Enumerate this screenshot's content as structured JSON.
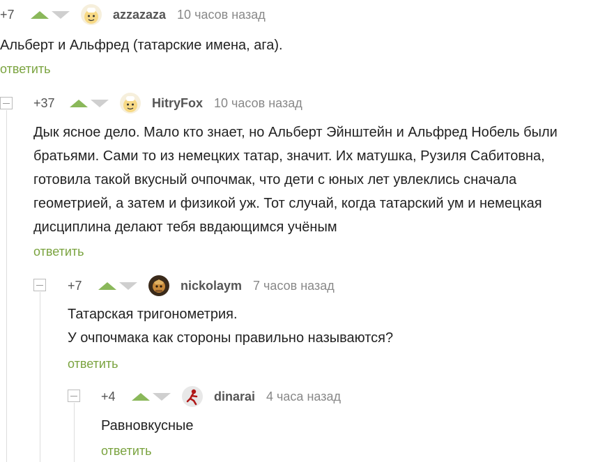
{
  "comments": [
    {
      "rating": "+7",
      "user": "azzazaza",
      "time": "10 часов назад",
      "lines": [
        "Альберт и Альфред (татарские имена, ага)."
      ],
      "reply": "ответить",
      "avatar_icon": "cartoon-face-avatar-icon"
    },
    {
      "rating": "+37",
      "user": "HitryFox",
      "time": "10 часов назад",
      "lines": [
        "Дык ясное дело. Мало кто знает, но Альберт Эйнштейн и Альфред Нобель были",
        "братьями. Сами то из немецких татар, значит. Их матушка, Рузиля Сабитовна,",
        "готовила такой вкусный очпочмак, что дети с юных лет увлеклись сначала",
        "геометрией, а затем и физикой уж. Тот случай, когда татарский ум и немецкая",
        "дисциплина делают тебя ввдающимся учёным"
      ],
      "reply": "ответить",
      "avatar_icon": "cartoon-face-avatar-icon"
    },
    {
      "rating": "+7",
      "user": "nickolaym",
      "time": "7 часов назад",
      "lines": [
        "Татарская тригонометрия.",
        "У очпочмака как стороны правильно называются?"
      ],
      "reply": "ответить",
      "avatar_icon": "photo-avatar-icon"
    },
    {
      "rating": "+4",
      "user": "dinarai",
      "time": "4 часа назад",
      "lines": [
        "Равновкусные"
      ],
      "reply": "ответить",
      "avatar_icon": "figure-avatar-icon"
    }
  ],
  "colors": {
    "upvote": "#8ab85a",
    "downvote": "#cfcfcf",
    "reply_link": "#7aa33f",
    "thread_line": "#dddddd"
  }
}
